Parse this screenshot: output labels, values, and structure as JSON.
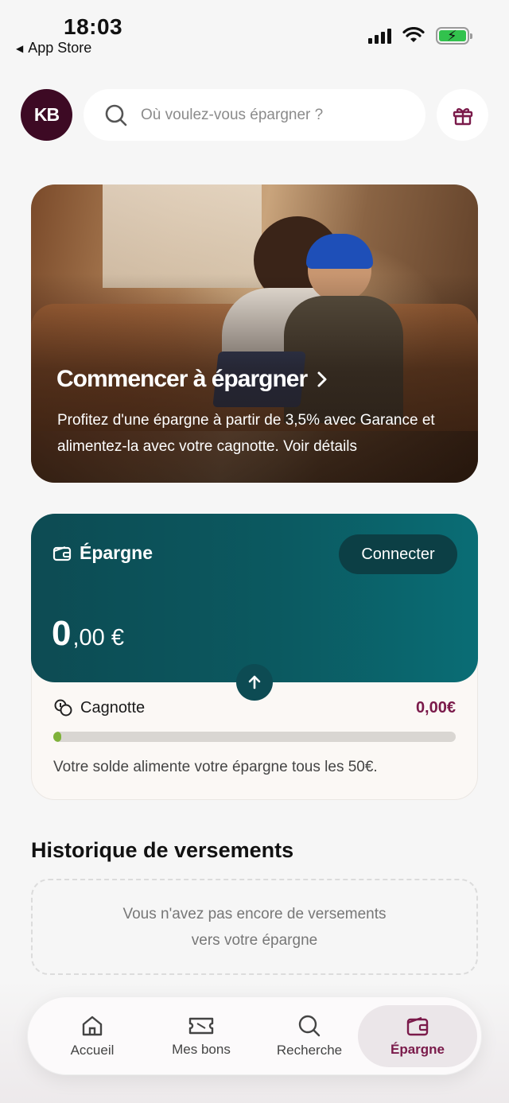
{
  "status_bar": {
    "time": "18:03",
    "back_label": "App Store"
  },
  "header": {
    "avatar_initials": "KB",
    "search_placeholder": "Où voulez-vous épargner ?"
  },
  "hero": {
    "title": "Commencer à épargner",
    "description": "Profitez d'une épargne à partir de 3,5% avec Garance et alimentez-la avec votre cagnotte. Voir détails"
  },
  "savings": {
    "title": "Épargne",
    "connect_label": "Connecter",
    "balance_int": "0",
    "balance_dec": ",00 €",
    "cagnotte_label": "Cagnotte",
    "cagnotte_value": "0,00€",
    "cagnotte_progress": 0.02,
    "info": "Votre solde alimente votre épargne tous les 50€."
  },
  "history": {
    "title": "Historique de versements",
    "empty_line1": "Vous n'avez pas encore de versements",
    "empty_line2": "vers votre épargne"
  },
  "nav": {
    "items": [
      {
        "label": "Accueil",
        "icon": "home-icon"
      },
      {
        "label": "Mes bons",
        "icon": "ticket-icon"
      },
      {
        "label": "Recherche",
        "icon": "search-icon"
      },
      {
        "label": "Épargne",
        "icon": "wallet-icon",
        "active": true
      }
    ]
  },
  "colors": {
    "brand": "#7a1a4a",
    "avatar_bg": "#3d0a24",
    "savings_card": "#0b5960",
    "progress_fill": "#7fb23a"
  }
}
